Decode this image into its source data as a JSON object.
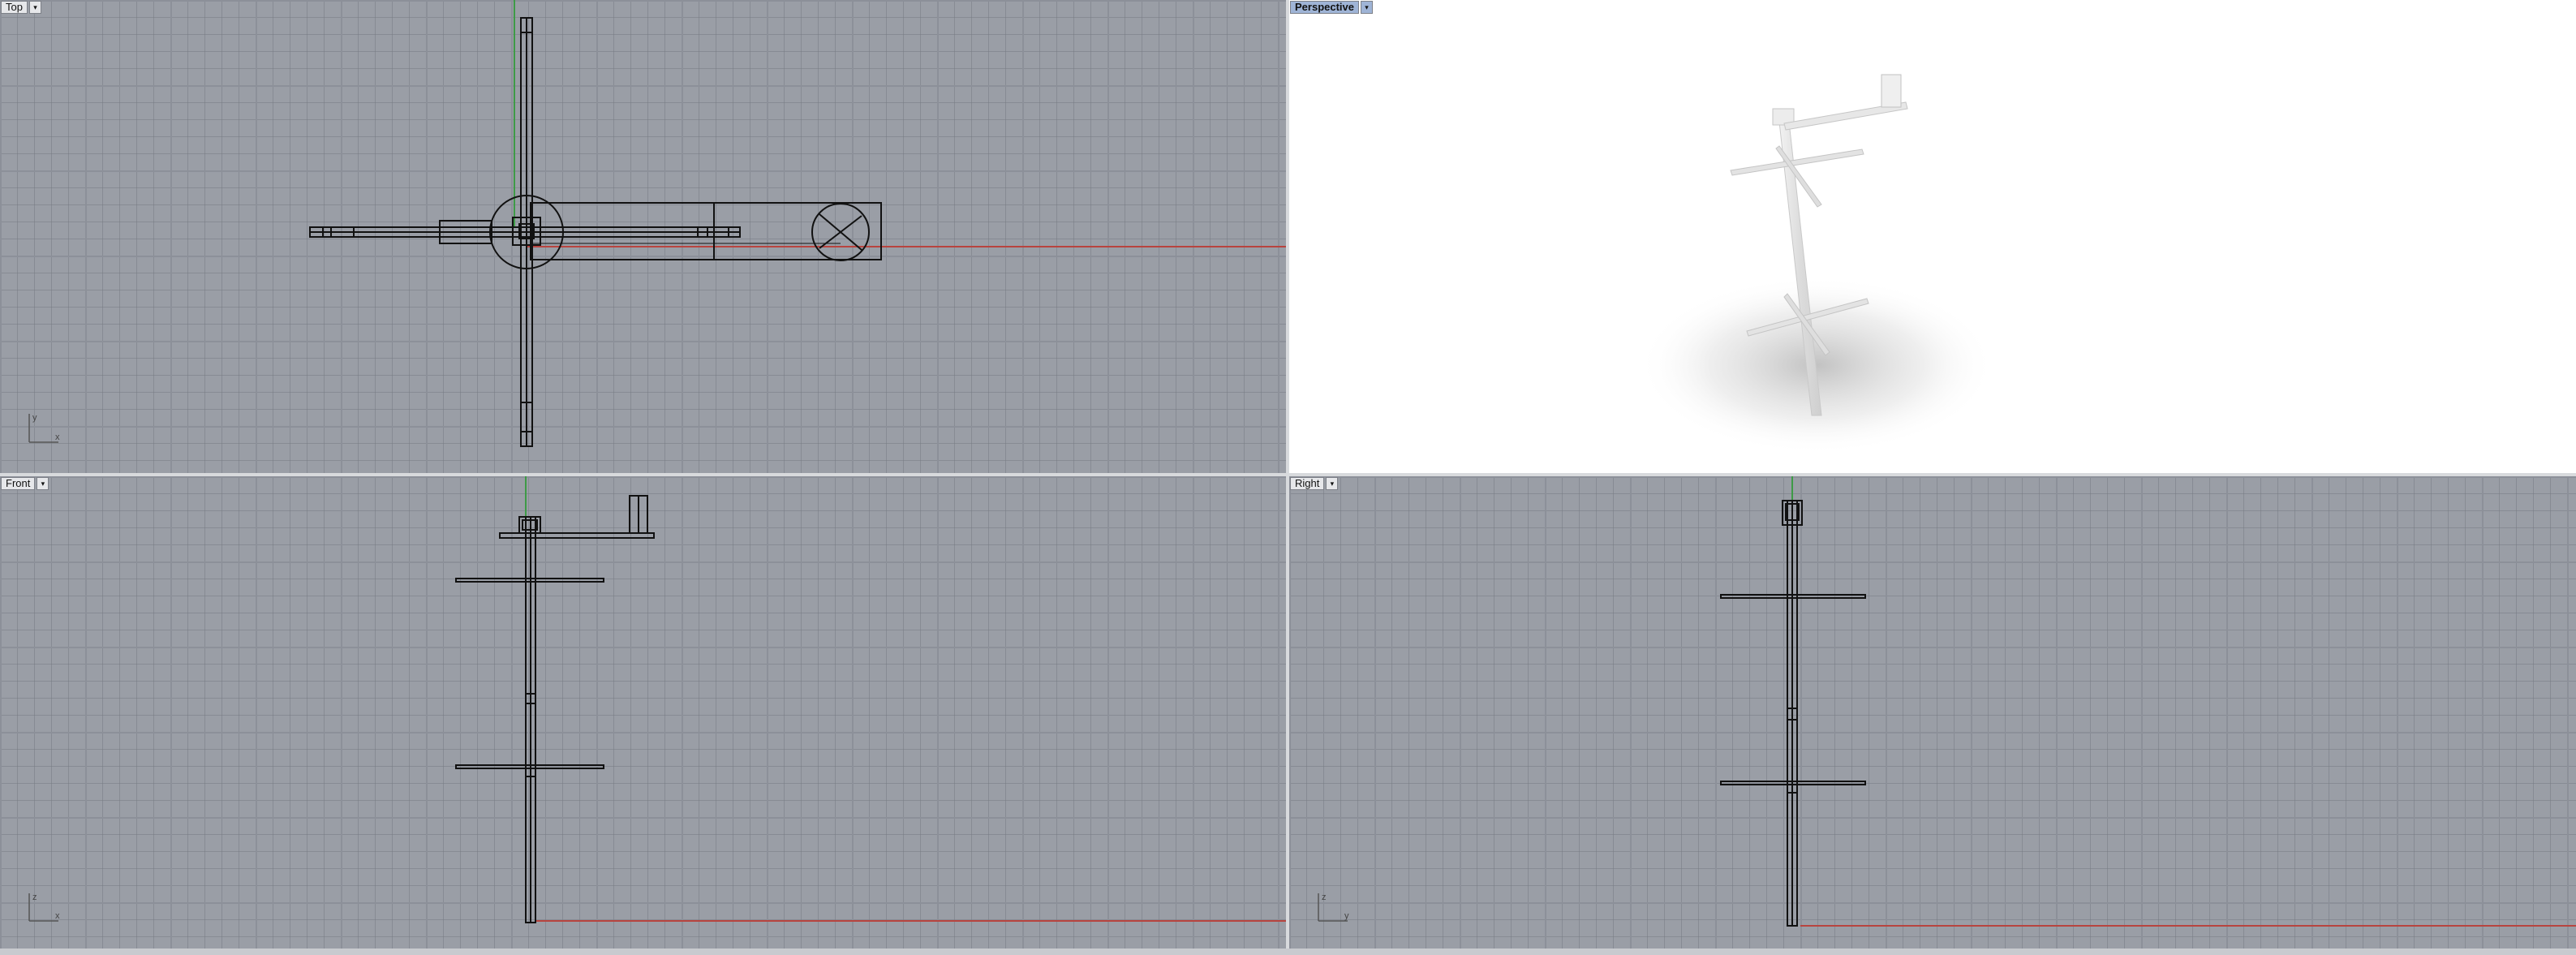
{
  "viewports": {
    "top": {
      "label": "Top",
      "dropdown": "▾",
      "axis_x": "x",
      "axis_y": "y"
    },
    "perspective": {
      "label": "Perspective",
      "dropdown": "▾"
    },
    "front": {
      "label": "Front",
      "dropdown": "▾",
      "axis_x": "x",
      "axis_y": "z"
    },
    "right": {
      "label": "Right",
      "dropdown": "▾",
      "axis_x": "y",
      "axis_y": "z"
    }
  },
  "colors": {
    "grid_bg": "#9a9ea6",
    "x_axis": "#b8443f",
    "y_axis": "#3e9a47",
    "wire": "#111111",
    "active_tab": "#9fb4d6"
  }
}
